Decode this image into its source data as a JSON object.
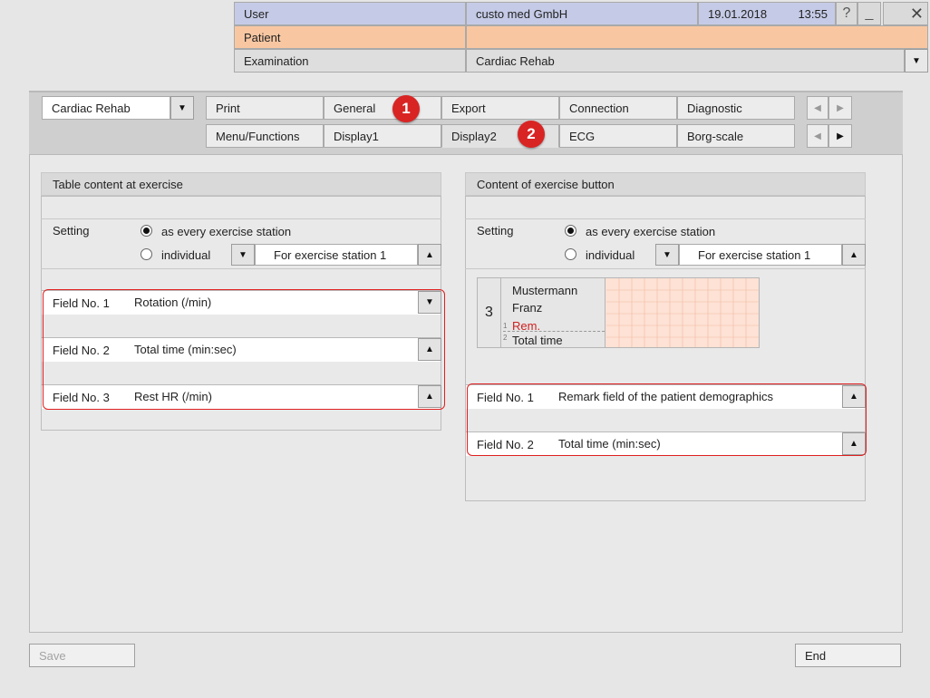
{
  "header": {
    "user_label": "User",
    "user_value": "custo med GmbH",
    "date": "19.01.2018",
    "time": "13:55",
    "patient_label": "Patient",
    "patient_value": "",
    "exam_label": "Examination",
    "exam_value": "Cardiac Rehab"
  },
  "window_buttons": {
    "help": "?",
    "minimize": "_",
    "close": "✕"
  },
  "mode_select": {
    "value": "Cardiac Rehab"
  },
  "tabs_row1": [
    "Print",
    "General",
    "Export",
    "Connection",
    "Diagnostic"
  ],
  "tabs_row2": [
    "Menu/Functions",
    "Display1",
    "Display2",
    "ECG",
    "Borg-scale"
  ],
  "badges": [
    "1",
    "2"
  ],
  "left_group": {
    "title": "Table content at exercise",
    "setting_label": "Setting",
    "radio_every": "as every exercise station",
    "radio_individual": "individual",
    "station_select": "For exercise station 1",
    "fields": [
      {
        "label": "Field No. 1",
        "value": "Rotation (/min)"
      },
      {
        "label": "Field No. 2",
        "value": "Total time (min:sec)"
      },
      {
        "label": "Field No. 3",
        "value": "Rest HR (/min)"
      }
    ]
  },
  "right_group": {
    "title": "Content of exercise button",
    "setting_label": "Setting",
    "radio_every": "as every exercise station",
    "radio_individual": "individual",
    "station_select": "For exercise station 1",
    "preview": {
      "number": "3",
      "name1": "Mustermann",
      "name2": "Franz",
      "row1_index": "1",
      "row1_text": "Rem.",
      "row2_index": "2",
      "row2_text": "Total time"
    },
    "fields": [
      {
        "label": "Field No. 1",
        "value": "Remark field of the patient demographics"
      },
      {
        "label": "Field No. 2",
        "value": "Total time (min:sec)"
      }
    ]
  },
  "buttons": {
    "save": "Save",
    "end": "End"
  },
  "colors": {
    "user_bg": "#c5cbe6",
    "patient_bg": "#f8c7a2",
    "highlight": "#e02020",
    "rem_text": "#d02020"
  }
}
